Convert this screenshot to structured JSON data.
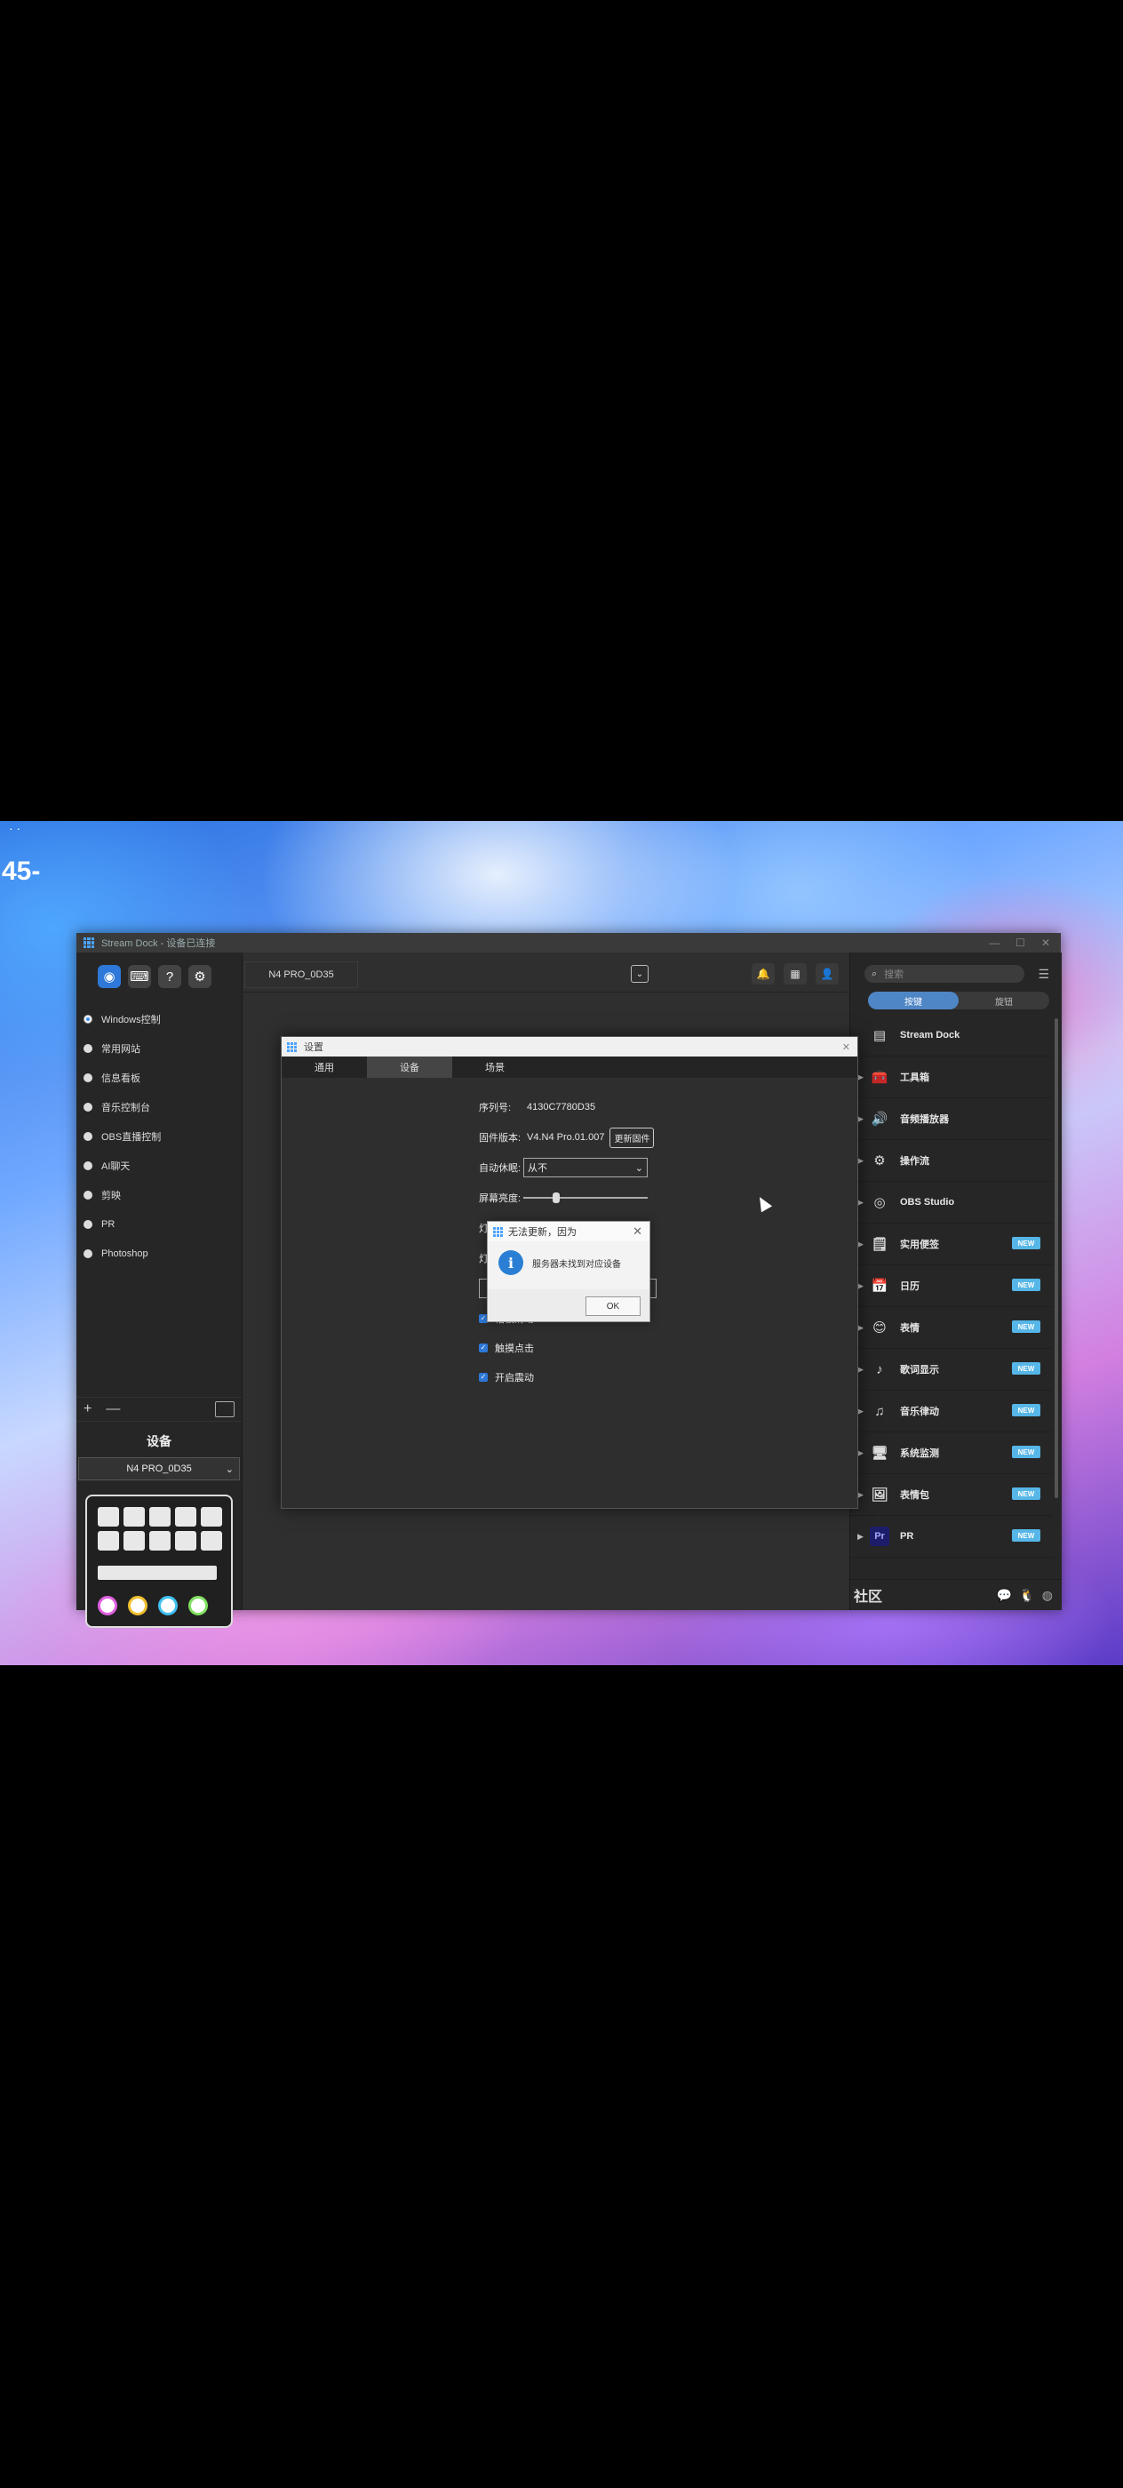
{
  "desktop": {
    "clock_fragment": "45-",
    "clock_top": "· ·"
  },
  "window": {
    "title": "Stream Dock - 设备已连接",
    "controls": [
      "—",
      "☐",
      "✕"
    ]
  },
  "toolbar": {
    "buttons": [
      {
        "icon": "plugin-store-icon",
        "glyph": "◉"
      },
      {
        "icon": "keyboard-icon",
        "glyph": "⌨"
      },
      {
        "icon": "help-icon",
        "glyph": "?"
      },
      {
        "icon": "gear-icon",
        "glyph": "⚙"
      }
    ]
  },
  "sidebar": {
    "items": [
      {
        "label": "Windows控制",
        "selected": true
      },
      {
        "label": "常用网站"
      },
      {
        "label": "信息看板"
      },
      {
        "label": "音乐控制台"
      },
      {
        "label": "OBS直播控制"
      },
      {
        "label": "AI聊天"
      },
      {
        "label": "剪映"
      },
      {
        "label": "PR"
      },
      {
        "label": "Photoshop"
      }
    ],
    "add_glyph": "+",
    "remove_glyph": "—",
    "device_heading": "设备",
    "device_name": "N4 PRO_0D35"
  },
  "device_preview": {
    "knob_colors": [
      "#e060e0",
      "#f0c030",
      "#40c0f0",
      "#80e060"
    ]
  },
  "main": {
    "device_tab": "N4 PRO_0D35",
    "dropdown_glyph": "⌄"
  },
  "top_icons": [
    {
      "icon": "bell-icon",
      "glyph": "🔔"
    },
    {
      "icon": "grid-apps-icon",
      "glyph": "▦"
    },
    {
      "icon": "user-icon",
      "glyph": "👤"
    }
  ],
  "right_panel": {
    "search_placeholder": "搜索",
    "tabs": [
      "按键",
      "旋钮"
    ],
    "plugins": [
      {
        "name": "Stream Dock",
        "icon": "stream-dock-icon",
        "glyph": "▤",
        "new": false,
        "arrow": false
      },
      {
        "name": "工具箱",
        "icon": "toolbox-icon",
        "glyph": "🧰",
        "new": false,
        "arrow": true
      },
      {
        "name": "音频播放器",
        "icon": "speaker-icon",
        "glyph": "🔊",
        "new": false,
        "arrow": true
      },
      {
        "name": "操作流",
        "icon": "flow-icon",
        "glyph": "⚙",
        "new": false,
        "arrow": true
      },
      {
        "name": "OBS Studio",
        "icon": "obs-icon",
        "glyph": "◎",
        "new": false,
        "arrow": true
      },
      {
        "name": "实用便签",
        "icon": "sticky-note-icon",
        "glyph": "🗒",
        "new": true,
        "arrow": true
      },
      {
        "name": "日历",
        "icon": "calendar-icon",
        "glyph": "📅",
        "new": true,
        "arrow": true
      },
      {
        "name": "表情",
        "icon": "emoji-icon",
        "glyph": "😊",
        "new": true,
        "arrow": true
      },
      {
        "name": "歌词显示",
        "icon": "music-note-icon",
        "glyph": "♪",
        "new": true,
        "arrow": true
      },
      {
        "name": "音乐律动",
        "icon": "equalizer-icon",
        "glyph": "♫",
        "new": true,
        "arrow": true
      },
      {
        "name": "系统监测",
        "icon": "monitor-icon",
        "glyph": "🖥",
        "new": true,
        "arrow": true
      },
      {
        "name": "表情包",
        "icon": "sticker-icon",
        "glyph": "🖼",
        "new": true,
        "arrow": true
      },
      {
        "name": "PR",
        "icon": "premiere-icon",
        "glyph": "Pr",
        "new": true,
        "arrow": true
      }
    ],
    "new_badge": "NEW",
    "community_label": "社区"
  },
  "settings": {
    "title": "设置",
    "tabs": [
      {
        "label": "通用"
      },
      {
        "label": "设备",
        "active": true
      },
      {
        "label": "场景"
      }
    ],
    "serial_label": "序列号:",
    "serial_value": "4130C7780D35",
    "firmware_label": "固件版本:",
    "firmware_value": "V4.N4 Pro.01.007",
    "update_button": "更新固件",
    "auto_sleep_label": "自动休眠:",
    "auto_sleep_value": "从不",
    "brightness_label": "屏幕亮度:",
    "brightness_level": 0.25,
    "light_label_a": "灯",
    "light_label_b": "灯",
    "checkbox_a": "帽被滑动",
    "checkbox_b": "触摸点击",
    "checkbox_c": "开启震动"
  },
  "message_box": {
    "title": "无法更新，因为",
    "body": "服务器未找到对应设备",
    "ok": "OK"
  }
}
